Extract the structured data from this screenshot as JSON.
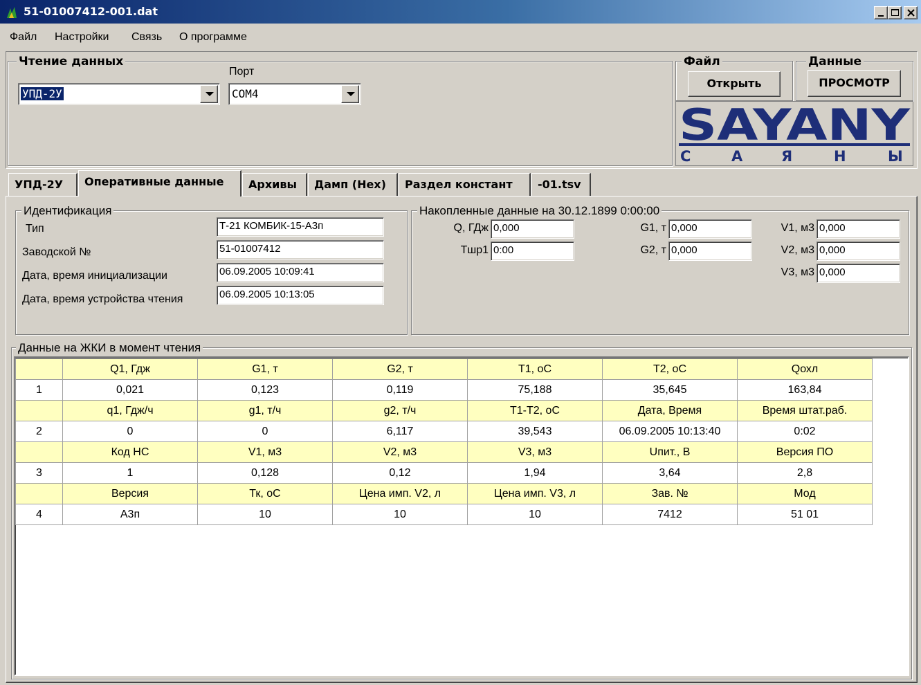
{
  "window": {
    "title": "51-01007412-001.dat"
  },
  "menu": [
    "Файл",
    "Настройки",
    "Связь",
    "О программе"
  ],
  "reading": {
    "legend": "Чтение данных",
    "device": "УПД-2У",
    "port_label": "Порт",
    "port": "COM4"
  },
  "file_group": {
    "legend": "Файл",
    "open_button": "Открыть"
  },
  "data_group": {
    "legend": "Данные",
    "view_button": "ПРОСМОТР"
  },
  "logo": {
    "main": "SAYANY",
    "sub": [
      "С",
      "А",
      "Я",
      "Н",
      "Ы"
    ]
  },
  "tabs": [
    "УПД-2У",
    "Оперативные данные",
    "Архивы",
    "Дамп (Hex)",
    "Раздел констант",
    "-01.tsv"
  ],
  "identification": {
    "legend": "Идентификация",
    "type_label": "Тип",
    "type": "Т-21 КОМБИК-15-А3п",
    "serial_label": "Заводской №",
    "serial": "51-01007412",
    "init_label": "Дата, время инициализации",
    "init": "06.09.2005  10:09:41",
    "read_label": "Дата, время устройства чтения",
    "read": "06.09.2005  10:13:05"
  },
  "accumulated": {
    "legend": "Накопленные данные на  30.12.1899  0:00:00",
    "q_label": "Q, ГДж",
    "q": "0,000",
    "tshr_label": "Тшр1",
    "tshr": "0:00",
    "g1_label": "G1, т",
    "g1": "0,000",
    "g2_label": "G2, т",
    "g2": "0,000",
    "v1_label": "V1, м3",
    "v1": "0,000",
    "v2_label": "V2, м3",
    "v2": "0,000",
    "v3_label": "V3, м3",
    "v3": "0,000"
  },
  "lcd": {
    "legend": "Данные на ЖКИ в момент чтения",
    "rows": [
      [
        "",
        "Q1, Гдж",
        "G1, т",
        "G2, т",
        "T1, оС",
        "T2, оС",
        "Qохл"
      ],
      [
        "1",
        "0,021",
        "0,123",
        "0,119",
        "75,188",
        "35,645",
        "163,84"
      ],
      [
        "",
        "q1, Гдж/ч",
        "g1, т/ч",
        "g2, т/ч",
        "T1-T2, оС",
        "Дата, Время",
        "Время штат.раб."
      ],
      [
        "2",
        "0",
        "0",
        "6,117",
        "39,543",
        "06.09.2005  10:13:40",
        "0:02"
      ],
      [
        "",
        "Код НС",
        "V1, м3",
        "V2, м3",
        "V3, м3",
        "Uпит., В",
        "Версия ПО"
      ],
      [
        "3",
        "1",
        "0,128",
        "0,12",
        "1,94",
        "3,64",
        "2,8"
      ],
      [
        "",
        "Версия",
        "Тк, оС",
        "Цена имп. V2, л",
        "Цена имп. V3, л",
        "Зав. №",
        "Мод"
      ],
      [
        "4",
        "А3п",
        "10",
        "10",
        "10",
        "7412",
        "51   01"
      ]
    ]
  },
  "colors": {
    "logo": "#1e2e78",
    "header_row": "#ffffc0",
    "selection": "#0a246a"
  }
}
